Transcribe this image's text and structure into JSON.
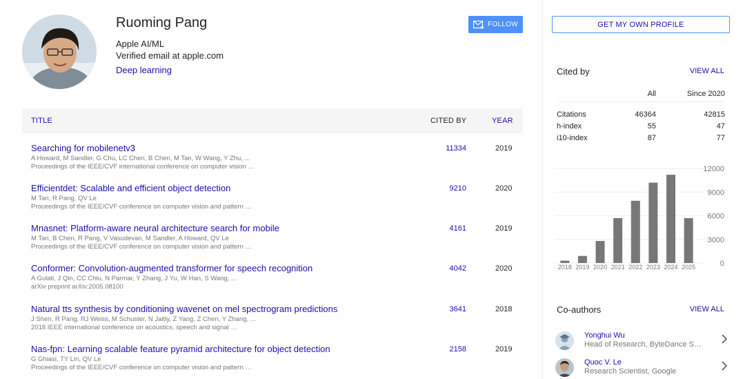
{
  "profile": {
    "name": "Ruoming Pang",
    "affiliation": "Apple AI/ML",
    "email": "Verified email at apple.com",
    "interest": "Deep learning",
    "follow_label": "FOLLOW"
  },
  "table": {
    "title_header": "TITLE",
    "cited_header": "CITED BY",
    "year_header": "YEAR",
    "rows": [
      {
        "title": "Searching for mobilenetv3",
        "authors": "A Howard, M Sandler, G Chu, LC Chen, B Chen, M Tan, W Wang, Y Zhu, ...",
        "venue": "Proceedings of the IEEE/CVF international conference on computer vision …",
        "cites": "11334",
        "year": "2019"
      },
      {
        "title": "Efficientdet: Scalable and efficient object detection",
        "authors": "M Tan, R Pang, QV Le",
        "venue": "Proceedings of the IEEE/CVF conference on computer vision and pattern …",
        "cites": "9210",
        "year": "2020"
      },
      {
        "title": "Mnasnet: Platform-aware neural architecture search for mobile",
        "authors": "M Tan, B Chen, R Pang, V Vasudevan, M Sandler, A Howard, QV Le",
        "venue": "Proceedings of the IEEE/CVF conference on computer vision and pattern …",
        "cites": "4161",
        "year": "2019"
      },
      {
        "title": "Conformer: Convolution-augmented transformer for speech recognition",
        "authors": "A Gulati, J Qin, CC Chiu, N Parmar, Y Zhang, J Yu, W Han, S Wang, ...",
        "venue": "arXiv preprint arXiv:2005.08100",
        "cites": "4042",
        "year": "2020"
      },
      {
        "title": "Natural tts synthesis by conditioning wavenet on mel spectrogram predictions",
        "authors": "J Shen, R Pang, RJ Weiss, M Schuster, N Jaitly, Z Yang, Z Chen, Y Zhang, ...",
        "venue": "2018 IEEE international conference on acoustics, speech and signal …",
        "cites": "3641",
        "year": "2018"
      },
      {
        "title": "Nas-fpn: Learning scalable feature pyramid architecture for object detection",
        "authors": "G Ghiasi, TY Lin, QV Le",
        "venue": "Proceedings of the IEEE/CVF conference on computer vision and pattern …",
        "cites": "2158",
        "year": "2019"
      }
    ]
  },
  "sidebar": {
    "get_profile_label": "GET MY OWN PROFILE",
    "cited_by_title": "Cited by",
    "view_all_label": "VIEW ALL",
    "col_all": "All",
    "col_since": "Since 2020",
    "stats": [
      {
        "label": "Citations",
        "all": "46364",
        "since": "42815"
      },
      {
        "label": "h-index",
        "all": "55",
        "since": "47"
      },
      {
        "label": "i10-index",
        "all": "87",
        "since": "77"
      }
    ],
    "coauthors_title": "Co-authors",
    "coauthors_view_all": "VIEW ALL",
    "coauthors": [
      {
        "name": "Yonghui Wu",
        "role": "Head of Research, ByteDance S…"
      },
      {
        "name": "Quoc V. Le",
        "role": "Research Scientist, Google"
      }
    ]
  },
  "chart_data": {
    "type": "bar",
    "categories": [
      "2018",
      "2019",
      "2020",
      "2021",
      "2022",
      "2023",
      "2024",
      "2025"
    ],
    "values": [
      300,
      900,
      2800,
      5700,
      7900,
      10200,
      11200,
      5700
    ],
    "yticks": [
      "0",
      "3000",
      "6000",
      "9000",
      "12000"
    ],
    "ylim": [
      0,
      12000
    ],
    "grid": true,
    "bar_color": "#777777"
  },
  "colors": {
    "link": "#1a0dab",
    "follow_button": "#4d90fe"
  }
}
